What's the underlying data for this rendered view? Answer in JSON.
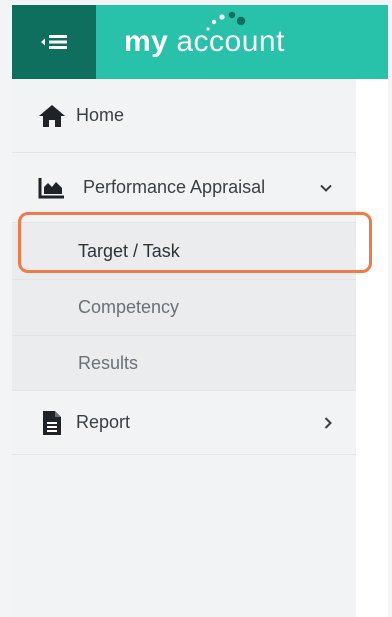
{
  "header": {
    "brand_bold": "my",
    "brand_light": "account",
    "colors": {
      "toggle_bg": "#0f6f5f",
      "brand_bg": "#27c2a9"
    },
    "toggle_icon": "menu-collapse-icon"
  },
  "sidebar": {
    "items": [
      {
        "label": "Home",
        "icon": "home-icon"
      },
      {
        "label": "Performance Appraisal",
        "icon": "area-chart-icon",
        "expanded": true,
        "children": [
          {
            "label": "Target / Task",
            "active": true
          },
          {
            "label": "Competency"
          },
          {
            "label": "Results"
          }
        ]
      },
      {
        "label": "Report",
        "icon": "document-icon"
      }
    ]
  },
  "highlight_color": "#ef7a4a"
}
